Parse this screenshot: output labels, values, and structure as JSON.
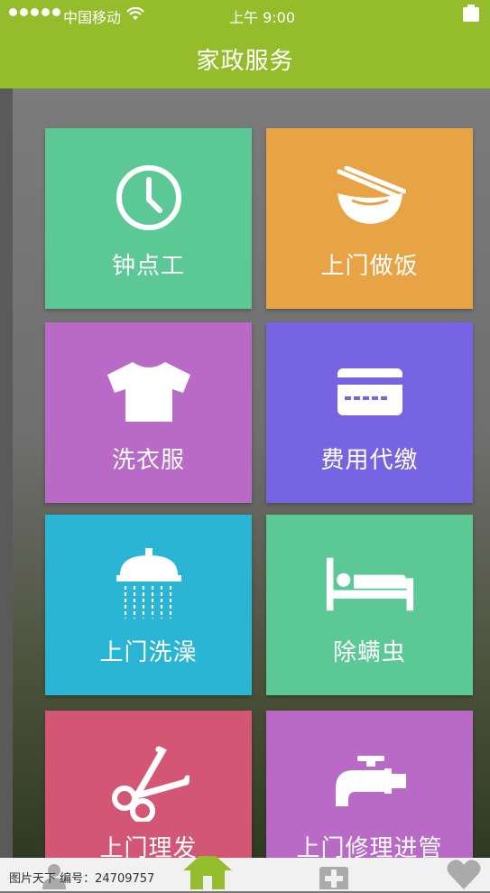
{
  "status_bar": {
    "carrier": "中国移动",
    "time": "上午 9:00"
  },
  "nav": {
    "title": "家政服务"
  },
  "tiles": [
    {
      "label": "钟点工",
      "color": "#5bc896",
      "icon": "clock-icon"
    },
    {
      "label": "上门做饭",
      "color": "#e8a444",
      "icon": "bowl-chopsticks-icon"
    },
    {
      "label": "洗衣服",
      "color": "#b969c6",
      "icon": "tshirt-icon"
    },
    {
      "label": "费用代缴",
      "color": "#7664e2",
      "icon": "credit-card-icon"
    },
    {
      "label": "上门洗澡",
      "color": "#2ab5d5",
      "icon": "shower-icon"
    },
    {
      "label": "除螨虫",
      "color": "#5bc896",
      "icon": "bed-icon"
    },
    {
      "label": "上门理发",
      "color": "#d35775",
      "icon": "scissors-icon"
    },
    {
      "label": "上门修理进管",
      "color": "#b969c6",
      "icon": "faucet-icon"
    }
  ],
  "tab_bar": {
    "items": [
      {
        "icon": "person-icon"
      },
      {
        "icon": "home-icon",
        "active_color": "#95bd2b"
      },
      {
        "icon": "plus-box-icon"
      },
      {
        "icon": "heart-icon"
      }
    ]
  },
  "watermark": "图片天下 编号：24709757",
  "colors": {
    "header_green": "#95bd2b",
    "tabbar_bg": "#f1f1f1",
    "icon_gray": "#aaaaaa"
  }
}
